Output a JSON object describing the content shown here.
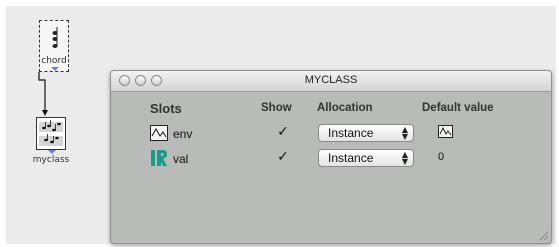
{
  "patch": {
    "chord_box": {
      "label": "chord",
      "icon": "chord-notes-icon"
    },
    "myclass_box": {
      "label": "myclass",
      "icon": "score-icon"
    }
  },
  "window": {
    "title": "MYCLASS",
    "headers": {
      "slots": "Slots",
      "show": "Show",
      "allocation": "Allocation",
      "default_value": "Default value"
    },
    "rows": [
      {
        "name": "env",
        "type_icon": "bpf-icon",
        "show_checked": true,
        "allocation": "Instance",
        "default_icon": "bpf-icon",
        "default_value": ""
      },
      {
        "name": "val",
        "type_icon": "real-number-icon",
        "show_checked": true,
        "allocation": "Instance",
        "default_icon": "",
        "default_value": "0"
      }
    ],
    "check_glyph": "✓"
  },
  "colors": {
    "canvas": "#ebebeb",
    "window_body": "#b8bbb7",
    "outlet_arrow": "#6e7fd6",
    "real_icon": "#1a9b8a"
  }
}
